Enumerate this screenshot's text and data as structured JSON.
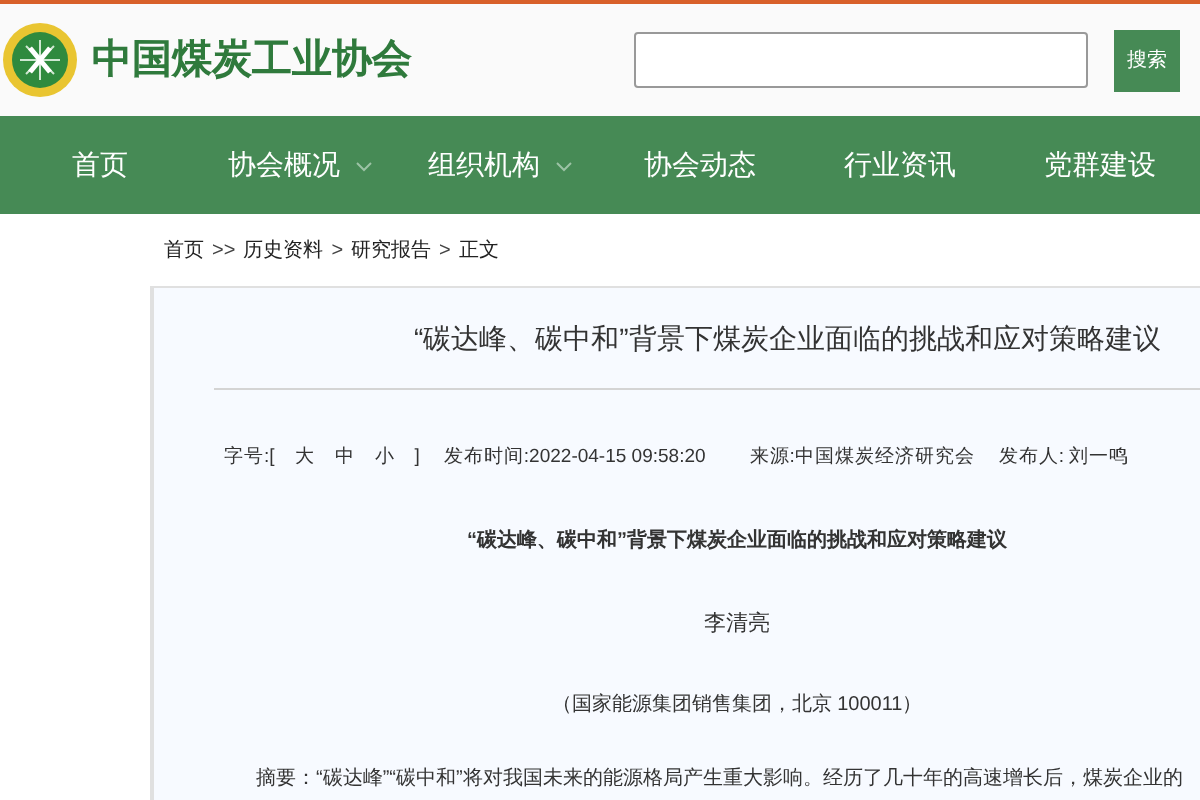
{
  "header": {
    "site_name": "中国煤炭工业协会",
    "search": {
      "button": "搜索"
    }
  },
  "nav": [
    {
      "label": "首页",
      "has_dropdown": false
    },
    {
      "label": "协会概况",
      "has_dropdown": true
    },
    {
      "label": "组织机构",
      "has_dropdown": true
    },
    {
      "label": "协会动态",
      "has_dropdown": false
    },
    {
      "label": "行业资讯",
      "has_dropdown": false
    },
    {
      "label": "党群建设",
      "has_dropdown": false
    }
  ],
  "breadcrumb": [
    {
      "label": "首页",
      "separator": ">>"
    },
    {
      "label": "历史资料",
      "separator": ">"
    },
    {
      "label": "研究报告",
      "separator": ">"
    },
    {
      "label": "正文"
    }
  ],
  "article": {
    "title": "“碳达峰、碳中和”背景下煤炭企业面临的挑战和应对策略建议",
    "font_size": {
      "label": "字号:[",
      "options": [
        "大",
        "中",
        "小"
      ],
      "end": "]"
    },
    "published": "发布时间:2022-04-15 09:58:20",
    "source": "来源:中国煤炭经济研究会",
    "publisher": "发布人: 刘一鸣",
    "subtitle": "“碳达峰、碳中和”背景下煤炭企业面临的挑战和应对策略建议",
    "author": "李清亮",
    "affiliation": "（国家能源集团销售集团，北京 100011）",
    "abstract": "摘要：“碳达峰”“碳中和”将对我国未来的能源格局产生重大影响。经历了几十年的高速增长后，煤炭企业的"
  }
}
